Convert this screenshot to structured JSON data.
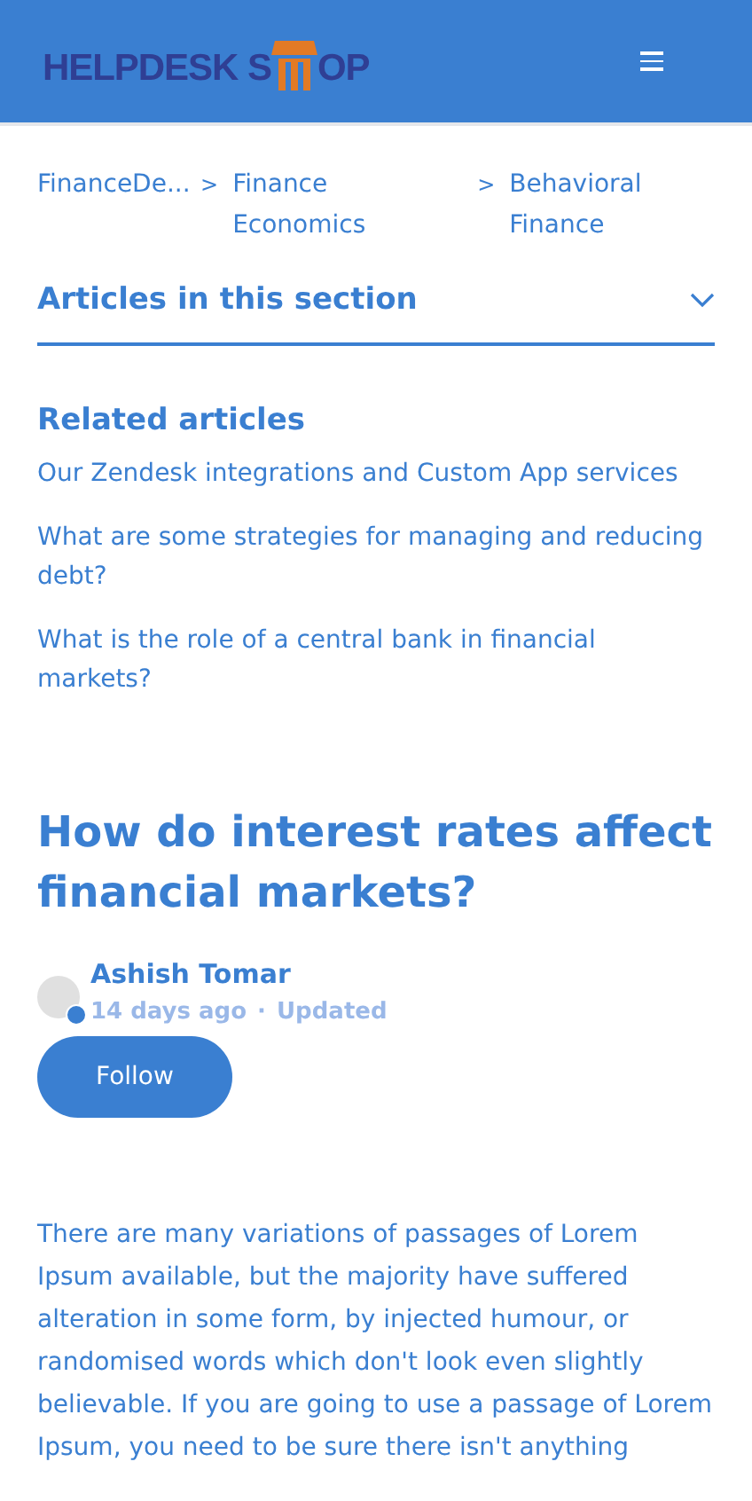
{
  "header": {
    "logo_start": "HELPDESK S",
    "logo_end": "OP"
  },
  "breadcrumbs": [
    {
      "label": "FinanceDe..."
    },
    {
      "label": "Finance Economics"
    },
    {
      "label": "Behavioral Finance"
    }
  ],
  "breadcrumb_separator": ">",
  "section_toggle": {
    "label": "Articles in this section",
    "expanded": false
  },
  "related": {
    "title": "Related articles",
    "links": [
      "Our Zendesk integrations and Custom App services",
      "What are some strategies for managing and reducing debt?",
      "What is the role of a central bank in financial markets?"
    ]
  },
  "article": {
    "title": "How do interest rates affect financial markets?",
    "author": "Ashish Tomar",
    "time": "14 days ago",
    "separator": "·",
    "updated": "Updated",
    "follow": "Follow",
    "body": "There are many variations of passages of Lorem Ipsum available, but the majority have suffered alteration in some form, by injected humour, or randomised words which don't look even slightly believable. If you are going to use a passage of Lorem Ipsum, you need to be sure there isn't anything"
  }
}
